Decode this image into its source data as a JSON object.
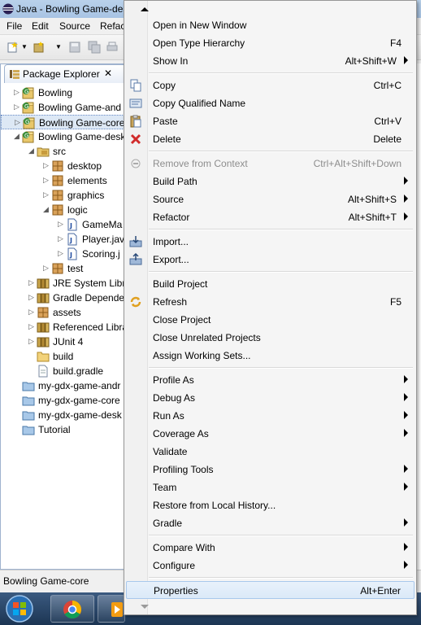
{
  "window": {
    "title": "Java - Bowling Game-des",
    "menus": [
      "File",
      "Edit",
      "Source",
      "Refac"
    ]
  },
  "explorer": {
    "tab_label": "Package Explorer",
    "close_glyph": "✕",
    "tree": [
      {
        "label": "Bowling",
        "arrow": "▷",
        "icon": "java-project-icon"
      },
      {
        "label": "Bowling Game-and",
        "arrow": "▷",
        "icon": "java-project-icon"
      },
      {
        "label": "Bowling Game-core",
        "arrow": "▷",
        "icon": "java-project-icon",
        "selected": true
      },
      {
        "label": "Bowling Game-desk",
        "arrow": "◢",
        "icon": "java-project-icon"
      },
      {
        "label": "src",
        "arrow": "◢",
        "icon": "source-folder-icon"
      },
      {
        "label": "desktop",
        "arrow": "▷",
        "icon": "package-icon"
      },
      {
        "label": "elements",
        "arrow": "▷",
        "icon": "package-icon"
      },
      {
        "label": "graphics",
        "arrow": "▷",
        "icon": "package-icon"
      },
      {
        "label": "logic",
        "arrow": "◢",
        "icon": "package-icon"
      },
      {
        "label": "GameMa",
        "arrow": "▷",
        "icon": "java-file-icon"
      },
      {
        "label": "Player.jav",
        "arrow": "▷",
        "icon": "java-file-icon"
      },
      {
        "label": "Scoring.j",
        "arrow": "▷",
        "icon": "java-file-icon"
      },
      {
        "label": "test",
        "arrow": "▷",
        "icon": "package-icon"
      },
      {
        "label": "JRE System Libra",
        "arrow": "▷",
        "icon": "library-icon"
      },
      {
        "label": "Gradle Depende",
        "arrow": "▷",
        "icon": "library-icon"
      },
      {
        "label": "assets",
        "arrow": "▷",
        "icon": "package-icon"
      },
      {
        "label": "Referenced Libra",
        "arrow": "▷",
        "icon": "library-icon"
      },
      {
        "label": "JUnit 4",
        "arrow": "▷",
        "icon": "library-icon"
      },
      {
        "label": "build",
        "arrow": "",
        "icon": "folder-icon"
      },
      {
        "label": "build.gradle",
        "arrow": "",
        "icon": "file-icon"
      },
      {
        "label": "my-gdx-game-andr",
        "arrow": "",
        "icon": "closed-project-icon"
      },
      {
        "label": "my-gdx-game-core",
        "arrow": "",
        "icon": "closed-project-icon"
      },
      {
        "label": "my-gdx-game-desk",
        "arrow": "",
        "icon": "closed-project-icon"
      },
      {
        "label": "Tutorial",
        "arrow": "",
        "icon": "closed-project-icon"
      }
    ]
  },
  "statusbar": {
    "text": "Bowling Game-core"
  },
  "context_menu": {
    "items": [
      {
        "label": "Open in New Window",
        "accel": ""
      },
      {
        "label": "Open Type Hierarchy",
        "accel": "F4"
      },
      {
        "label": "Show In",
        "accel": "Alt+Shift+W",
        "submenu": true
      },
      {
        "sep": true
      },
      {
        "label": "Copy",
        "accel": "Ctrl+C",
        "icon": "copy-icon"
      },
      {
        "label": "Copy Qualified Name",
        "accel": "",
        "icon": "copy-qualified-icon"
      },
      {
        "label": "Paste",
        "accel": "Ctrl+V",
        "icon": "paste-icon"
      },
      {
        "label": "Delete",
        "accel": "Delete",
        "icon": "delete-icon"
      },
      {
        "sep": true
      },
      {
        "label": "Remove from Context",
        "accel": "Ctrl+Alt+Shift+Down",
        "disabled": true,
        "icon": "remove-context-icon"
      },
      {
        "label": "Build Path",
        "accel": "",
        "submenu": true
      },
      {
        "label": "Source",
        "accel": "Alt+Shift+S",
        "submenu": true
      },
      {
        "label": "Refactor",
        "accel": "Alt+Shift+T",
        "submenu": true
      },
      {
        "sep": true
      },
      {
        "label": "Import...",
        "accel": "",
        "icon": "import-icon"
      },
      {
        "label": "Export...",
        "accel": "",
        "icon": "export-icon"
      },
      {
        "sep": true
      },
      {
        "label": "Build Project",
        "accel": ""
      },
      {
        "label": "Refresh",
        "accel": "F5",
        "icon": "refresh-icon"
      },
      {
        "label": "Close Project",
        "accel": ""
      },
      {
        "label": "Close Unrelated Projects",
        "accel": ""
      },
      {
        "label": "Assign Working Sets...",
        "accel": ""
      },
      {
        "sep": true
      },
      {
        "label": "Profile As",
        "accel": "",
        "submenu": true
      },
      {
        "label": "Debug As",
        "accel": "",
        "submenu": true
      },
      {
        "label": "Run As",
        "accel": "",
        "submenu": true
      },
      {
        "label": "Coverage As",
        "accel": "",
        "submenu": true
      },
      {
        "label": "Validate",
        "accel": ""
      },
      {
        "label": "Profiling Tools",
        "accel": "",
        "submenu": true
      },
      {
        "label": "Team",
        "accel": "",
        "submenu": true
      },
      {
        "label": "Restore from Local History...",
        "accel": ""
      },
      {
        "label": "Gradle",
        "accel": "",
        "submenu": true
      },
      {
        "sep": true
      },
      {
        "label": "Compare With",
        "accel": "",
        "submenu": true
      },
      {
        "label": "Configure",
        "accel": "",
        "submenu": true
      },
      {
        "sep": true
      },
      {
        "label": "Properties",
        "accel": "Alt+Enter",
        "hover": true
      }
    ]
  },
  "colors": {
    "menu_bg": "#f5f5f5",
    "hover_bg": "#dbe9f8",
    "disabled_text": "#8d8d8d",
    "taskbar": "#1c3553"
  }
}
